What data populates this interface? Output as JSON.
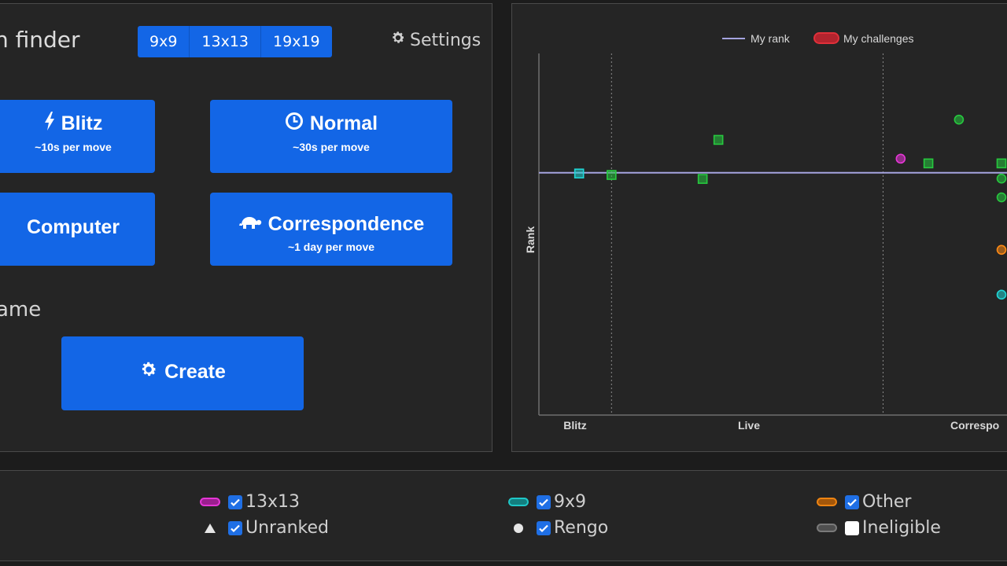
{
  "finder": {
    "title": "n finder",
    "sizes": [
      "9x9",
      "13x13",
      "19x19"
    ],
    "settings_label": "Settings",
    "buttons": {
      "blitz": {
        "label": "Blitz",
        "sub": "~10s per move"
      },
      "normal": {
        "label": "Normal",
        "sub": "~30s per move"
      },
      "computer": {
        "label": "Computer"
      },
      "correspondence": {
        "label": "Correspondence",
        "sub": "~1 day per move"
      }
    },
    "custom_title": "ame",
    "create_label": "Create"
  },
  "chart_data": {
    "type": "scatter",
    "ylabel": "Rank",
    "xlabel": "",
    "categories": [
      "Blitz",
      "Live",
      "Correspo"
    ],
    "legend": [
      {
        "name": "My rank",
        "kind": "line",
        "color": "#a5a4e0"
      },
      {
        "name": "My challenges",
        "kind": "pill",
        "color": "#e0303a"
      }
    ],
    "legend_position": "top",
    "my_rank": 0.67,
    "ylim": [
      0,
      1
    ],
    "xlim": [
      0,
      1
    ],
    "grid": false,
    "separators": [
      0.157,
      0.744
    ],
    "points": [
      {
        "x": 0.087,
        "y": 0.668,
        "shape": "square",
        "color": "#1fd6d6"
      },
      {
        "x": 0.157,
        "y": 0.664,
        "shape": "square",
        "color": "#27c93f"
      },
      {
        "x": 0.388,
        "y": 0.761,
        "shape": "square",
        "color": "#27c93f"
      },
      {
        "x": 0.354,
        "y": 0.653,
        "shape": "square",
        "color": "#27c93f"
      },
      {
        "x": 0.908,
        "y": 0.817,
        "shape": "circle",
        "color": "#27c93f"
      },
      {
        "x": 0.782,
        "y": 0.709,
        "shape": "circle",
        "color": "#e536d6"
      },
      {
        "x": 0.842,
        "y": 0.696,
        "shape": "square",
        "color": "#27c93f"
      },
      {
        "x": 1.0,
        "y": 0.696,
        "shape": "square",
        "color": "#27c93f"
      },
      {
        "x": 1.0,
        "y": 0.654,
        "shape": "circle",
        "color": "#27c93f"
      },
      {
        "x": 1.0,
        "y": 0.602,
        "shape": "circle",
        "color": "#27c93f"
      },
      {
        "x": 1.0,
        "y": 0.457,
        "shape": "circle",
        "color": "#ff8a14"
      },
      {
        "x": 1.0,
        "y": 0.333,
        "shape": "circle",
        "color": "#1fd6d6"
      }
    ]
  },
  "legend_panel": {
    "items": [
      {
        "label": "13x13",
        "color": "#e536d6",
        "checked": true
      },
      {
        "label": "9x9",
        "color": "#1fc7c7",
        "checked": true
      },
      {
        "label": "Other",
        "color": "#ee8412",
        "checked": true
      },
      {
        "label": "Unranked",
        "marker": "triangle",
        "checked": true
      },
      {
        "label": "Rengo",
        "marker": "circle",
        "checked": true
      },
      {
        "label": "Ineligible",
        "color": "#7a7a7a",
        "checked": false
      }
    ]
  }
}
